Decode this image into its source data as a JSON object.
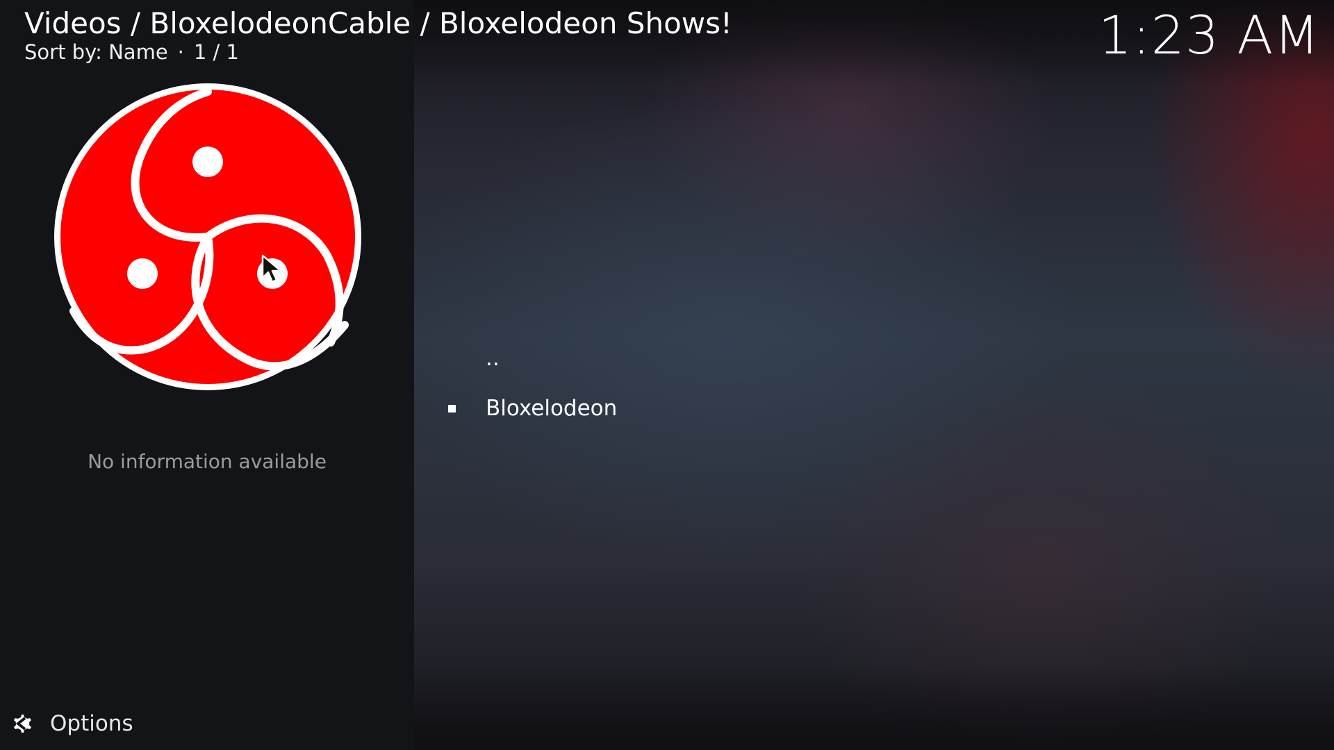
{
  "header": {
    "breadcrumb": "Videos / BloxelodeonCable / Bloxelodeon Shows!",
    "sort_label": "Sort by: Name",
    "separator": "·",
    "page_count": "1 / 1"
  },
  "clock": {
    "time": "1:23 AM"
  },
  "info_panel": {
    "thumbnail_icon": "triple-tomoe-logo",
    "no_info_text": "No information available"
  },
  "file_list": {
    "items": [
      {
        "label": "..",
        "icon": ""
      },
      {
        "label": "Bloxelodeon",
        "icon": "folder-bullet-icon"
      }
    ]
  },
  "options": {
    "label": "Options",
    "icon": "options-gear-icon"
  },
  "colors": {
    "logo_red": "#ff0000",
    "logo_white": "#ffffff",
    "panel_bg": "#131417",
    "muted_text": "#9c9ca0"
  }
}
